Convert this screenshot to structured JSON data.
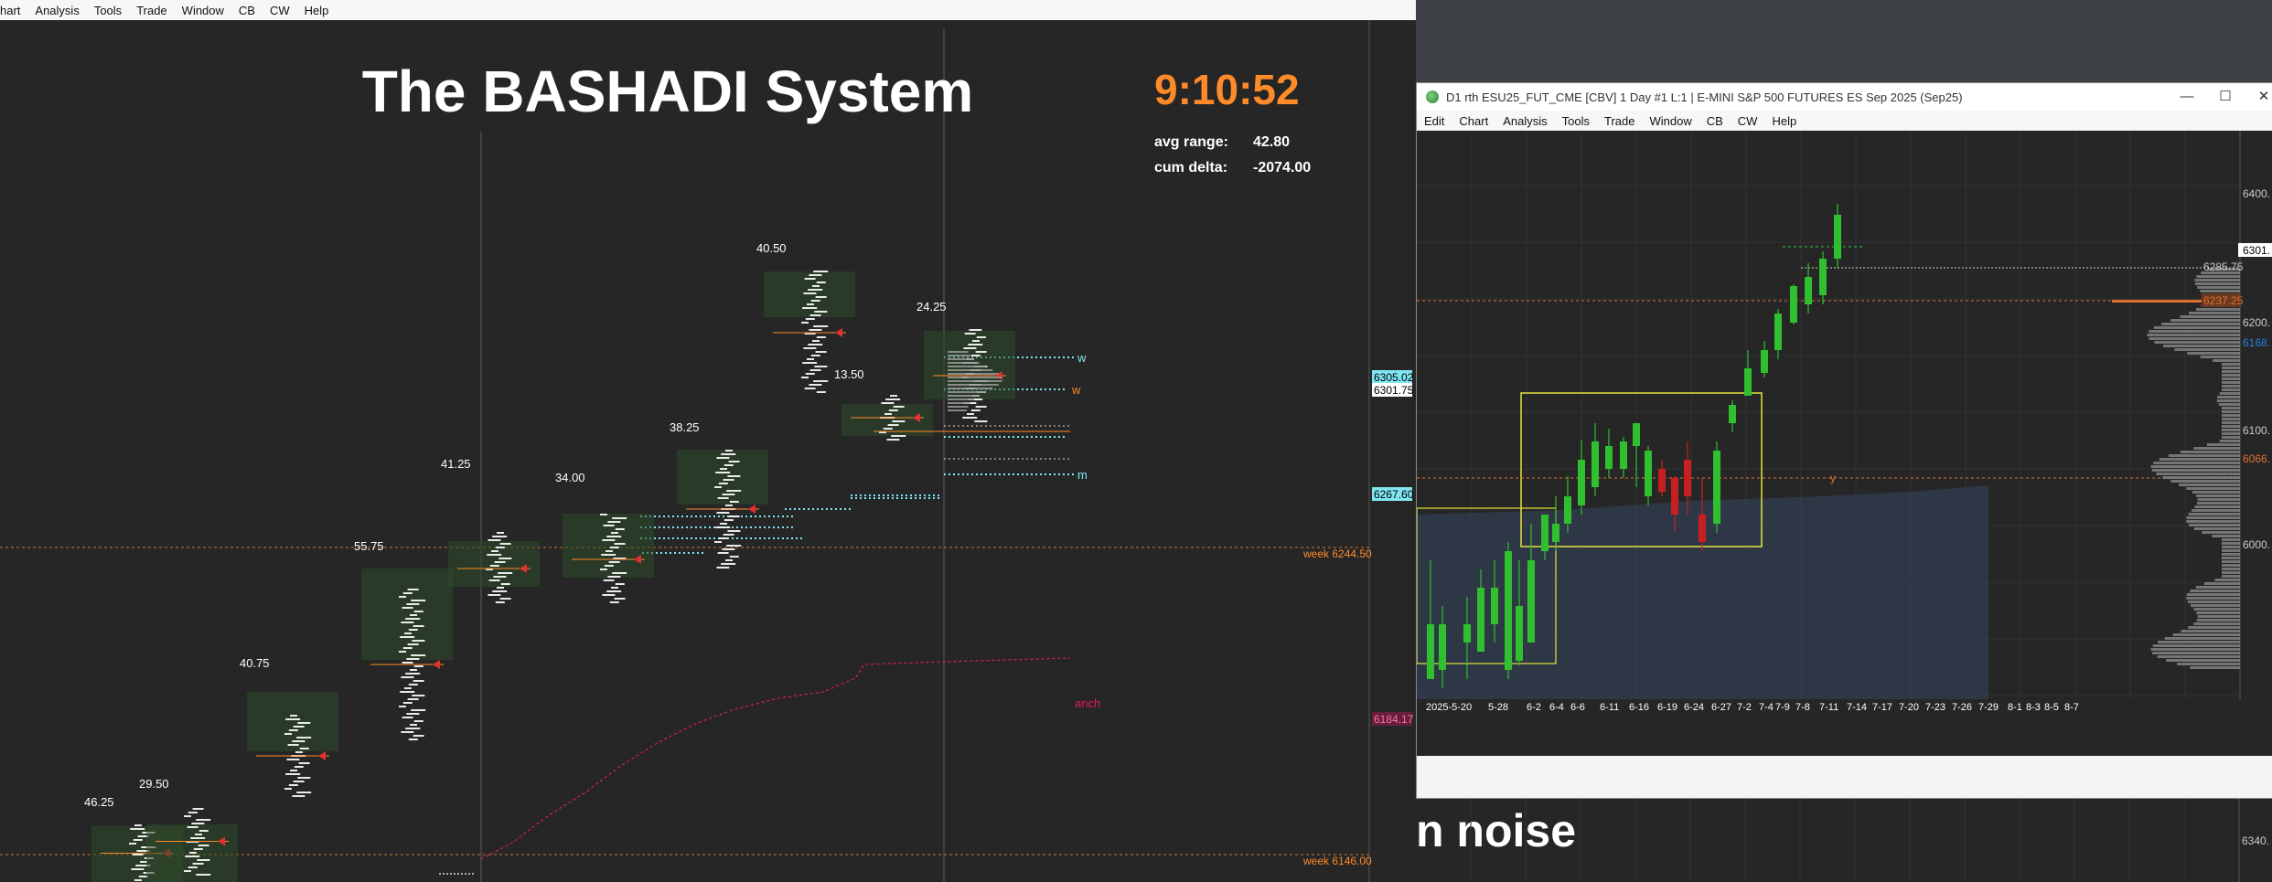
{
  "left_window": {
    "menu": [
      "hart",
      "Analysis",
      "Tools",
      "Trade",
      "Window",
      "CB",
      "CW",
      "Help"
    ],
    "title": "The BASHADI System",
    "clock": "9:10:52",
    "stats": [
      {
        "label": "avg range:",
        "value": "42.80"
      },
      {
        "label": "cum delta:",
        "value": "-2074.00"
      }
    ],
    "bar_range_labels": [
      "46.25",
      "29.50",
      "40.75",
      "55.75",
      "41.25",
      "34.00",
      "38.25",
      "40.50",
      "13.50",
      "24.25"
    ],
    "level_tags": {
      "week_upper": "week 6244.50",
      "week_lower": "week 6146.00",
      "anch": "anch",
      "w1": "w",
      "w2": "w",
      "m": "m"
    },
    "price_tags": [
      "6305.02",
      "6301.75",
      "6267.60",
      "6184.17"
    ],
    "colors": {
      "orange": "#ff8a2a",
      "cyan": "#7fe6f2",
      "magenta": "#e0176d",
      "background": "#262626"
    }
  },
  "right_window": {
    "title": "D1 rth ESU25_FUT_CME [CBV]  1 Day  #1 L:1 | E-MINI S&P 500 FUTURES ES Sep 2025 (Sep25)",
    "controls": {
      "minimize": "—",
      "maximize": "☐",
      "close": "✕"
    },
    "menu": [
      "Edit",
      "Chart",
      "Analysis",
      "Tools",
      "Trade",
      "Window",
      "CB",
      "CW",
      "Help"
    ],
    "price_axis": [
      "6400.",
      "6301.",
      "6285.75",
      "6237.25",
      "6200.",
      "6168.",
      "6100.",
      "6066.",
      "6000."
    ],
    "date_axis": [
      "2025-5-20",
      "5-28",
      "6-2",
      "6-4",
      "6-6",
      "6-11",
      "6-16",
      "6-19",
      "6-24",
      "6-27",
      "7-2",
      "7-4",
      "7-9",
      "7-8",
      "7-11",
      "7-14",
      "7-17",
      "7-20",
      "7-23",
      "7-26",
      "7-29",
      "8-1",
      "8-3",
      "8-5",
      "8-7"
    ],
    "level_tag": "y"
  },
  "lower_window": {
    "text": "n noise",
    "price_axis": "6340."
  }
}
